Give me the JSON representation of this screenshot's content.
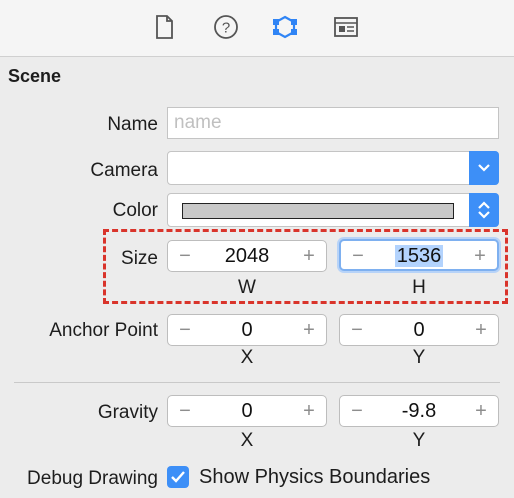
{
  "toolbar": {
    "icons": [
      "file-inspector-icon",
      "quick-help-icon",
      "attributes-inspector-icon",
      "size-inspector-icon"
    ],
    "active_color": "#2f84f5"
  },
  "section": {
    "title": "Scene"
  },
  "name": {
    "label": "Name",
    "placeholder": "name",
    "value": ""
  },
  "camera": {
    "label": "Camera",
    "value": ""
  },
  "color": {
    "label": "Color",
    "swatch": "#c8c8c8"
  },
  "size": {
    "label": "Size",
    "width": {
      "value": "2048",
      "sublabel": "W"
    },
    "height": {
      "value": "1536",
      "sublabel": "H"
    }
  },
  "anchor": {
    "label": "Anchor Point",
    "x": {
      "value": "0",
      "sublabel": "X"
    },
    "y": {
      "value": "0",
      "sublabel": "Y"
    }
  },
  "gravity": {
    "label": "Gravity",
    "x": {
      "value": "0",
      "sublabel": "X"
    },
    "y": {
      "value": "-9.8",
      "sublabel": "Y"
    }
  },
  "debug": {
    "label": "Debug Drawing",
    "checkbox_label": "Show Physics Boundaries",
    "checked": true
  },
  "stepper": {
    "minus": "−",
    "plus": "+"
  }
}
